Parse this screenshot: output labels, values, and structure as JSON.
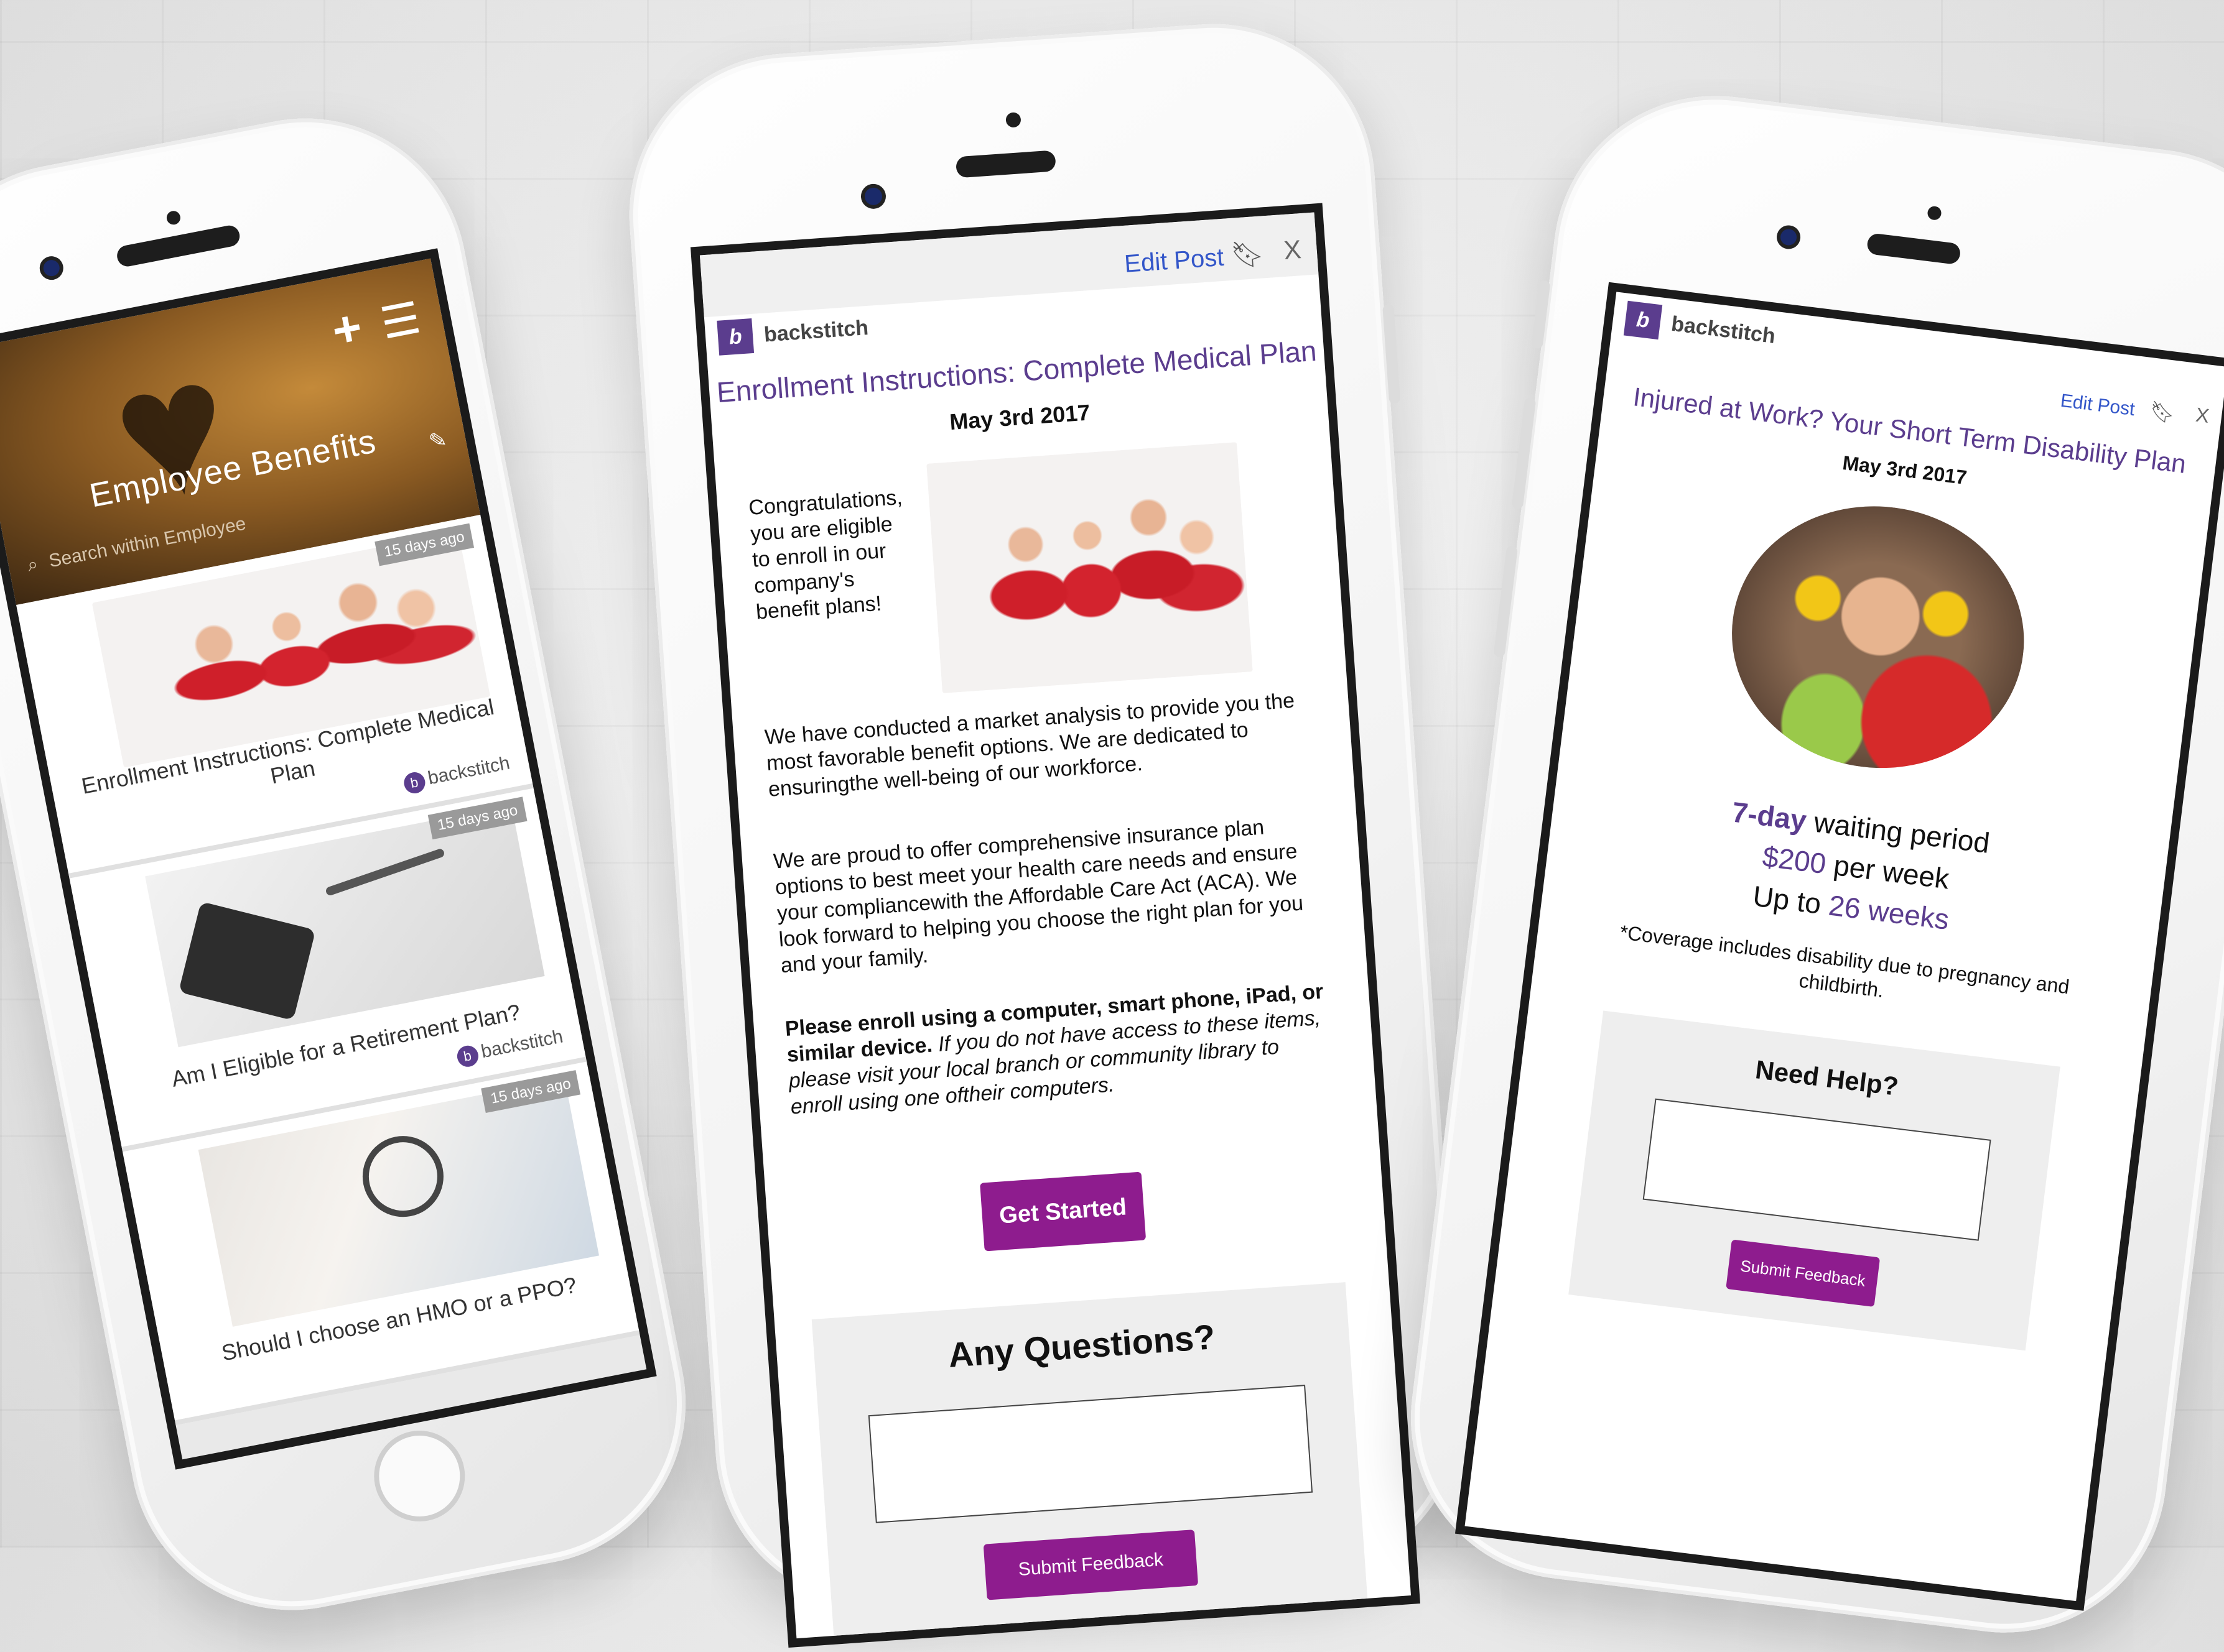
{
  "feed": {
    "hero_title": "Employee Benefits",
    "search_placeholder": "Search within Employee",
    "cards": [
      {
        "badge": "15 days ago",
        "title": "Enrollment Instructions: Complete Medical Plan",
        "source": "backstitch"
      },
      {
        "badge": "15 days ago",
        "title": "Am I Eligible for a Retirement Plan?",
        "source": "backstitch"
      },
      {
        "badge": "15 days ago",
        "title": "Should I choose an HMO or a PPO?",
        "source": ""
      }
    ]
  },
  "post": {
    "edit_label": "Edit Post",
    "close_label": "X",
    "brand": "backstitch",
    "title": "Enrollment Instructions: Complete Medical Plan",
    "date": "May 3rd 2017",
    "para1": "Congratulations, you are eligible to enroll in our company's benefit plans!",
    "para2": "We have conducted a market analysis to provide you the most favorable benefit options. We are dedicated to ensuringthe well-being of our workforce.",
    "para3": "We are proud to offer comprehensive insurance plan options to best meet your health care needs and ensure your compliancewith the Affordable Care Act (ACA). We look forward to helping you choose the right plan for you and your family.",
    "para4_bold": "Please enroll using a computer, smart phone, iPad, or similar device.",
    "para4_italic": "If you do not have access to these items, please visit your local branch or community library to enroll using one oftheir computers.",
    "cta": "Get Started",
    "questions_title": "Any Questions?",
    "submit": "Submit Feedback"
  },
  "disability": {
    "brand": "backstitch",
    "edit_label": "Edit Post",
    "close_label": "X",
    "title": "Injured at Work? Your Short Term Disability Plan",
    "date": "May 3rd 2017",
    "waiting_value": "7-day",
    "waiting_text": "waiting period",
    "pay_value": "$200",
    "pay_text": "per week",
    "upto_text": "Up to",
    "upto_value": "26 weeks",
    "note": "*Coverage includes disability due to pregnancy and childbirth.",
    "help_title": "Need Help?",
    "submit": "Submit Feedback"
  },
  "colors": {
    "brand_purple": "#5b3d8e",
    "button_magenta": "#8e1c8e",
    "link_blue": "#3356c9"
  }
}
